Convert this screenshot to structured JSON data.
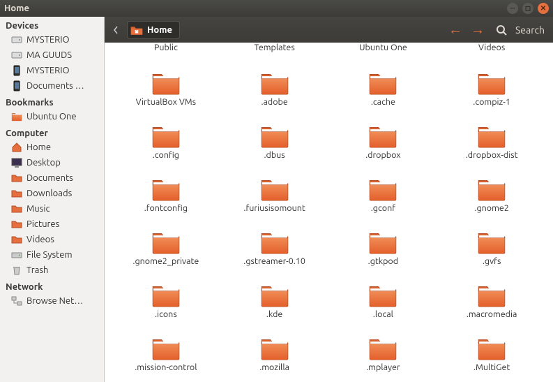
{
  "window": {
    "title": "Home"
  },
  "toolbar": {
    "path": "Home",
    "search": "Search"
  },
  "sidebar": {
    "sections": [
      {
        "title": "Devices",
        "items": [
          {
            "label": "MYSTERIO",
            "icon": "drive"
          },
          {
            "label": "MA GUUDS",
            "icon": "drive"
          },
          {
            "label": "MYSTERIO",
            "icon": "phone"
          },
          {
            "label": "Documents …",
            "icon": "phone"
          }
        ]
      },
      {
        "title": "Bookmarks",
        "items": [
          {
            "label": "Ubuntu One",
            "icon": "folder-orange"
          }
        ]
      },
      {
        "title": "Computer",
        "items": [
          {
            "label": "Home",
            "icon": "home"
          },
          {
            "label": "Desktop",
            "icon": "desktop"
          },
          {
            "label": "Documents",
            "icon": "folder"
          },
          {
            "label": "Downloads",
            "icon": "folder"
          },
          {
            "label": "Music",
            "icon": "folder"
          },
          {
            "label": "Pictures",
            "icon": "folder"
          },
          {
            "label": "Videos",
            "icon": "folder"
          },
          {
            "label": "File System",
            "icon": "disk"
          },
          {
            "label": "Trash",
            "icon": "trash"
          }
        ]
      },
      {
        "title": "Network",
        "items": [
          {
            "label": "Browse Net…",
            "icon": "network"
          }
        ]
      }
    ]
  },
  "grid": {
    "partialRow": [
      "Public",
      "Templates",
      "Ubuntu One",
      "Videos"
    ],
    "folders": [
      "VirtualBox VMs",
      ".adobe",
      ".cache",
      ".compiz-1",
      ".config",
      ".dbus",
      ".dropbox",
      ".dropbox-dist",
      ".fontconfig",
      ".furiusisomount",
      ".gconf",
      ".gnome2",
      ".gnome2_private",
      ".gstreamer-0.10",
      ".gtkpod",
      ".gvfs",
      ".icons",
      ".kde",
      ".local",
      ".macromedia",
      ".mission-control",
      ".mozilla",
      ".mplayer",
      ".MultiGet"
    ]
  }
}
